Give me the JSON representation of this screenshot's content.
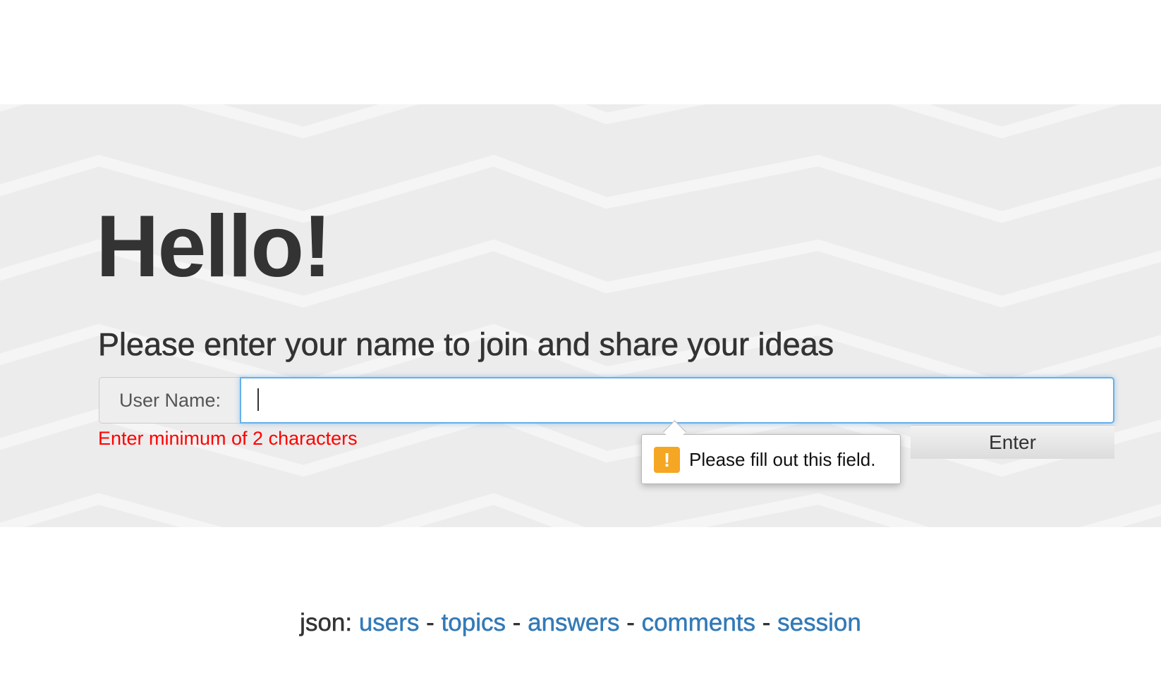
{
  "hero": {
    "heading": "Hello!",
    "subtitle": "Please enter your name to join and share your ideas"
  },
  "form": {
    "label": "User Name:",
    "input_value": "",
    "validation_message": "Enter minimum of 2 characters",
    "submit_label": "Enter"
  },
  "tooltip": {
    "icon": "warning-icon",
    "icon_glyph": "!",
    "message": "Please fill out this field."
  },
  "footer": {
    "prefix": "json:",
    "separator": "-",
    "links": [
      {
        "label": "users"
      },
      {
        "label": "topics"
      },
      {
        "label": "answers"
      },
      {
        "label": "comments"
      },
      {
        "label": "session"
      }
    ]
  },
  "colors": {
    "link": "#337ab7",
    "error": "#ff0000",
    "focus_border": "#66afe9",
    "warning": "#f5a623"
  }
}
